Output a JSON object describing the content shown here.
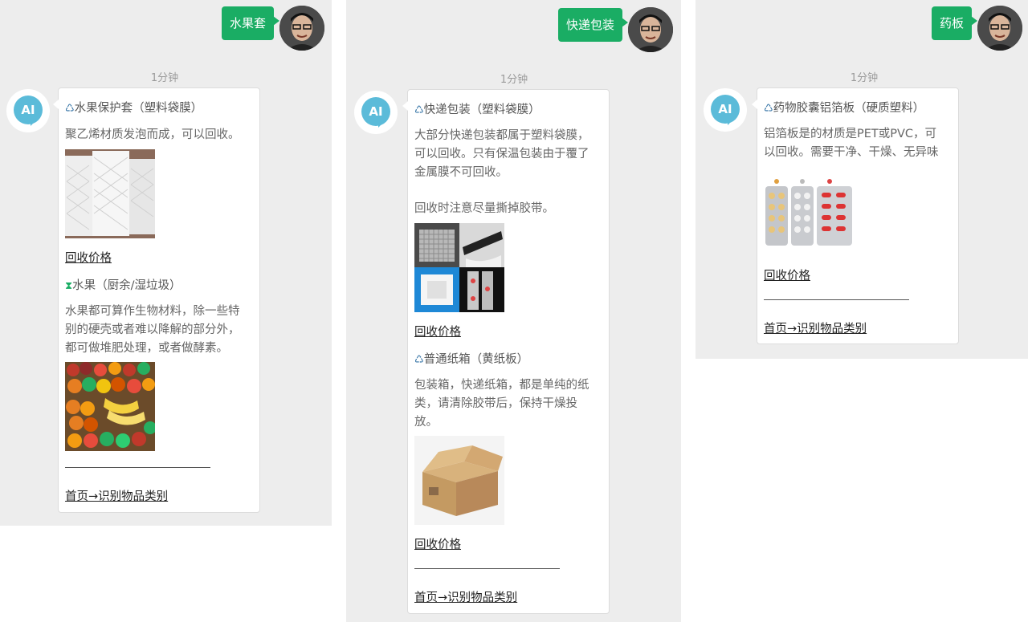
{
  "panels": [
    {
      "user_message": "水果套",
      "timestamp": "1分钟",
      "ai_avatar_label": "AI",
      "items": [
        {
          "category_icon": "recycle-triangle-icon",
          "title": "水果保护套（塑料袋膜）",
          "desc_lines": [
            "聚乙烯材质发泡而成，可以回收。"
          ],
          "image": "foam-fruit-sleeve-photo",
          "link": "回收价格"
        },
        {
          "category_icon": "hourglass-icon",
          "title": "水果（厨余/湿垃圾）",
          "desc_lines": [
            "水果都可算作生物材料，除一些特",
            "别的硬壳或者难以降解的部分外，",
            "都可做堆肥处理，或者做酵素。"
          ],
          "image": "fruit-stand-photo"
        }
      ],
      "footer_link": "首页→识别物品类别"
    },
    {
      "user_message": "快递包装",
      "timestamp": "1分钟",
      "ai_avatar_label": "AI",
      "items": [
        {
          "category_icon": "recycle-triangle-icon",
          "title": "快递包装（塑料袋膜）",
          "desc_lines": [
            "大部分快递包装都属于塑料袋膜，",
            "可以回收。只有保温包装由于覆了",
            "金属膜不可回收。",
            "",
            "回收时注意尽量撕掉胶带。"
          ],
          "image": "packaging-collage-photo",
          "link": "回收价格"
        },
        {
          "category_icon": "recycle-triangle-icon",
          "title": "普通纸箱（黄纸板）",
          "desc_lines": [
            "包装箱，快递纸箱，都是单纯的纸",
            "类，请清除胶带后，保持干燥投",
            "放。"
          ],
          "image": "cardboard-box-photo",
          "link": "回收价格"
        }
      ],
      "footer_link": "首页→识别物品类别"
    },
    {
      "user_message": "药板",
      "timestamp": "1分钟",
      "ai_avatar_label": "AI",
      "items": [
        {
          "category_icon": "recycle-triangle-icon",
          "title": "药物胶囊铝箔板（硬质塑料）",
          "desc_lines": [
            "铝箔板是的材质是PET或PVC，可",
            "以回收。需要干净、干燥、无异味"
          ],
          "image": "blister-pack-photo",
          "link": "回收价格"
        }
      ],
      "footer_link": "首页→识别物品类别"
    }
  ],
  "colors": {
    "user_bubble": "#1aad64",
    "ai_avatar": "#5bbbd9",
    "chat_bg": "#ededed",
    "recycle_icon": "#2e6fa3"
  }
}
